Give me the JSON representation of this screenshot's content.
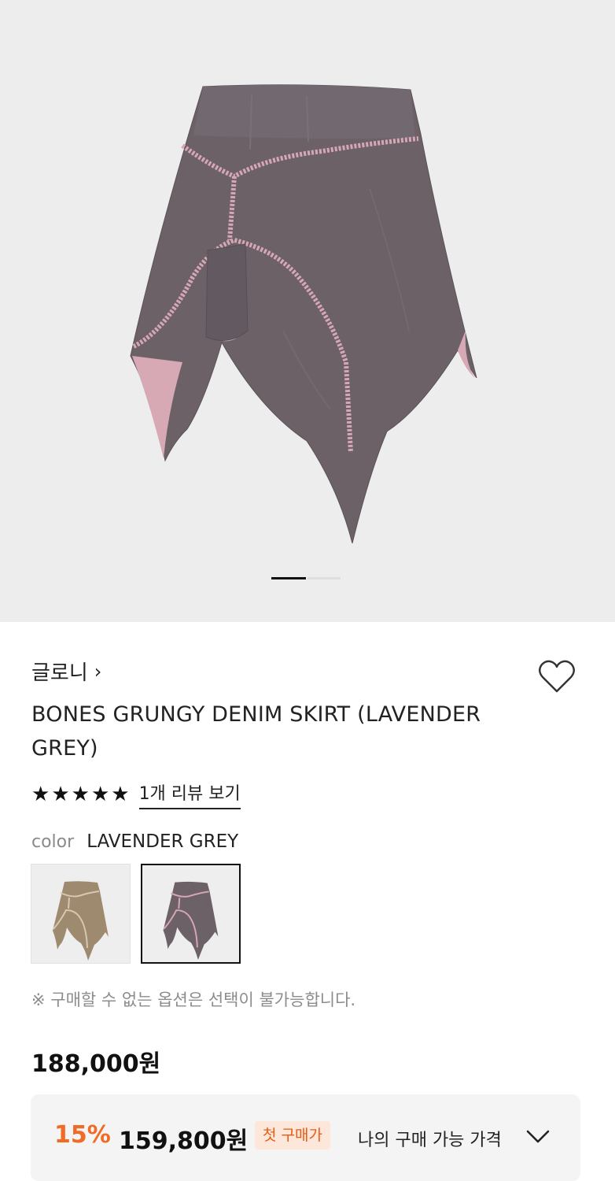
{
  "product": {
    "brand": "글로니",
    "brand_chevron": "›",
    "title": "BONES GRUNGY DENIM SKIRT (LAVENDER GREY)",
    "rating": {
      "stars": [
        "★",
        "★",
        "★",
        "★",
        "★"
      ],
      "value": 5,
      "review_link": "1개 리뷰 보기"
    },
    "color": {
      "label": "color",
      "selected": "LAVENDER GREY",
      "swatches": [
        {
          "name": "beige",
          "selected": false,
          "fabric": "#9e8a6f",
          "trim": "#d8c7b0"
        },
        {
          "name": "lavender grey",
          "selected": true,
          "fabric": "#6b6167",
          "trim": "#d6a6b4"
        }
      ]
    },
    "notice": "※ 구매할 수 없는 옵션은 선택이 불가능합니다.",
    "price": "188,000원",
    "discount": {
      "percent": "15%",
      "price": "159,800원",
      "badge": "첫 구매가",
      "my_price_label": "나의 구매 가능 가격"
    },
    "carousel": {
      "current": 1,
      "total": 2
    }
  },
  "colors": {
    "accent_orange": "#ef6b26",
    "badge_bg": "#fde6da",
    "hero_bg": "#ededed",
    "skirt_fabric": "#6b6167",
    "skirt_trim": "#d6a6b4"
  },
  "icons": {
    "wishlist": "heart-outline-icon",
    "expand": "chevron-down-icon",
    "brand_link": "chevron-right-icon"
  }
}
